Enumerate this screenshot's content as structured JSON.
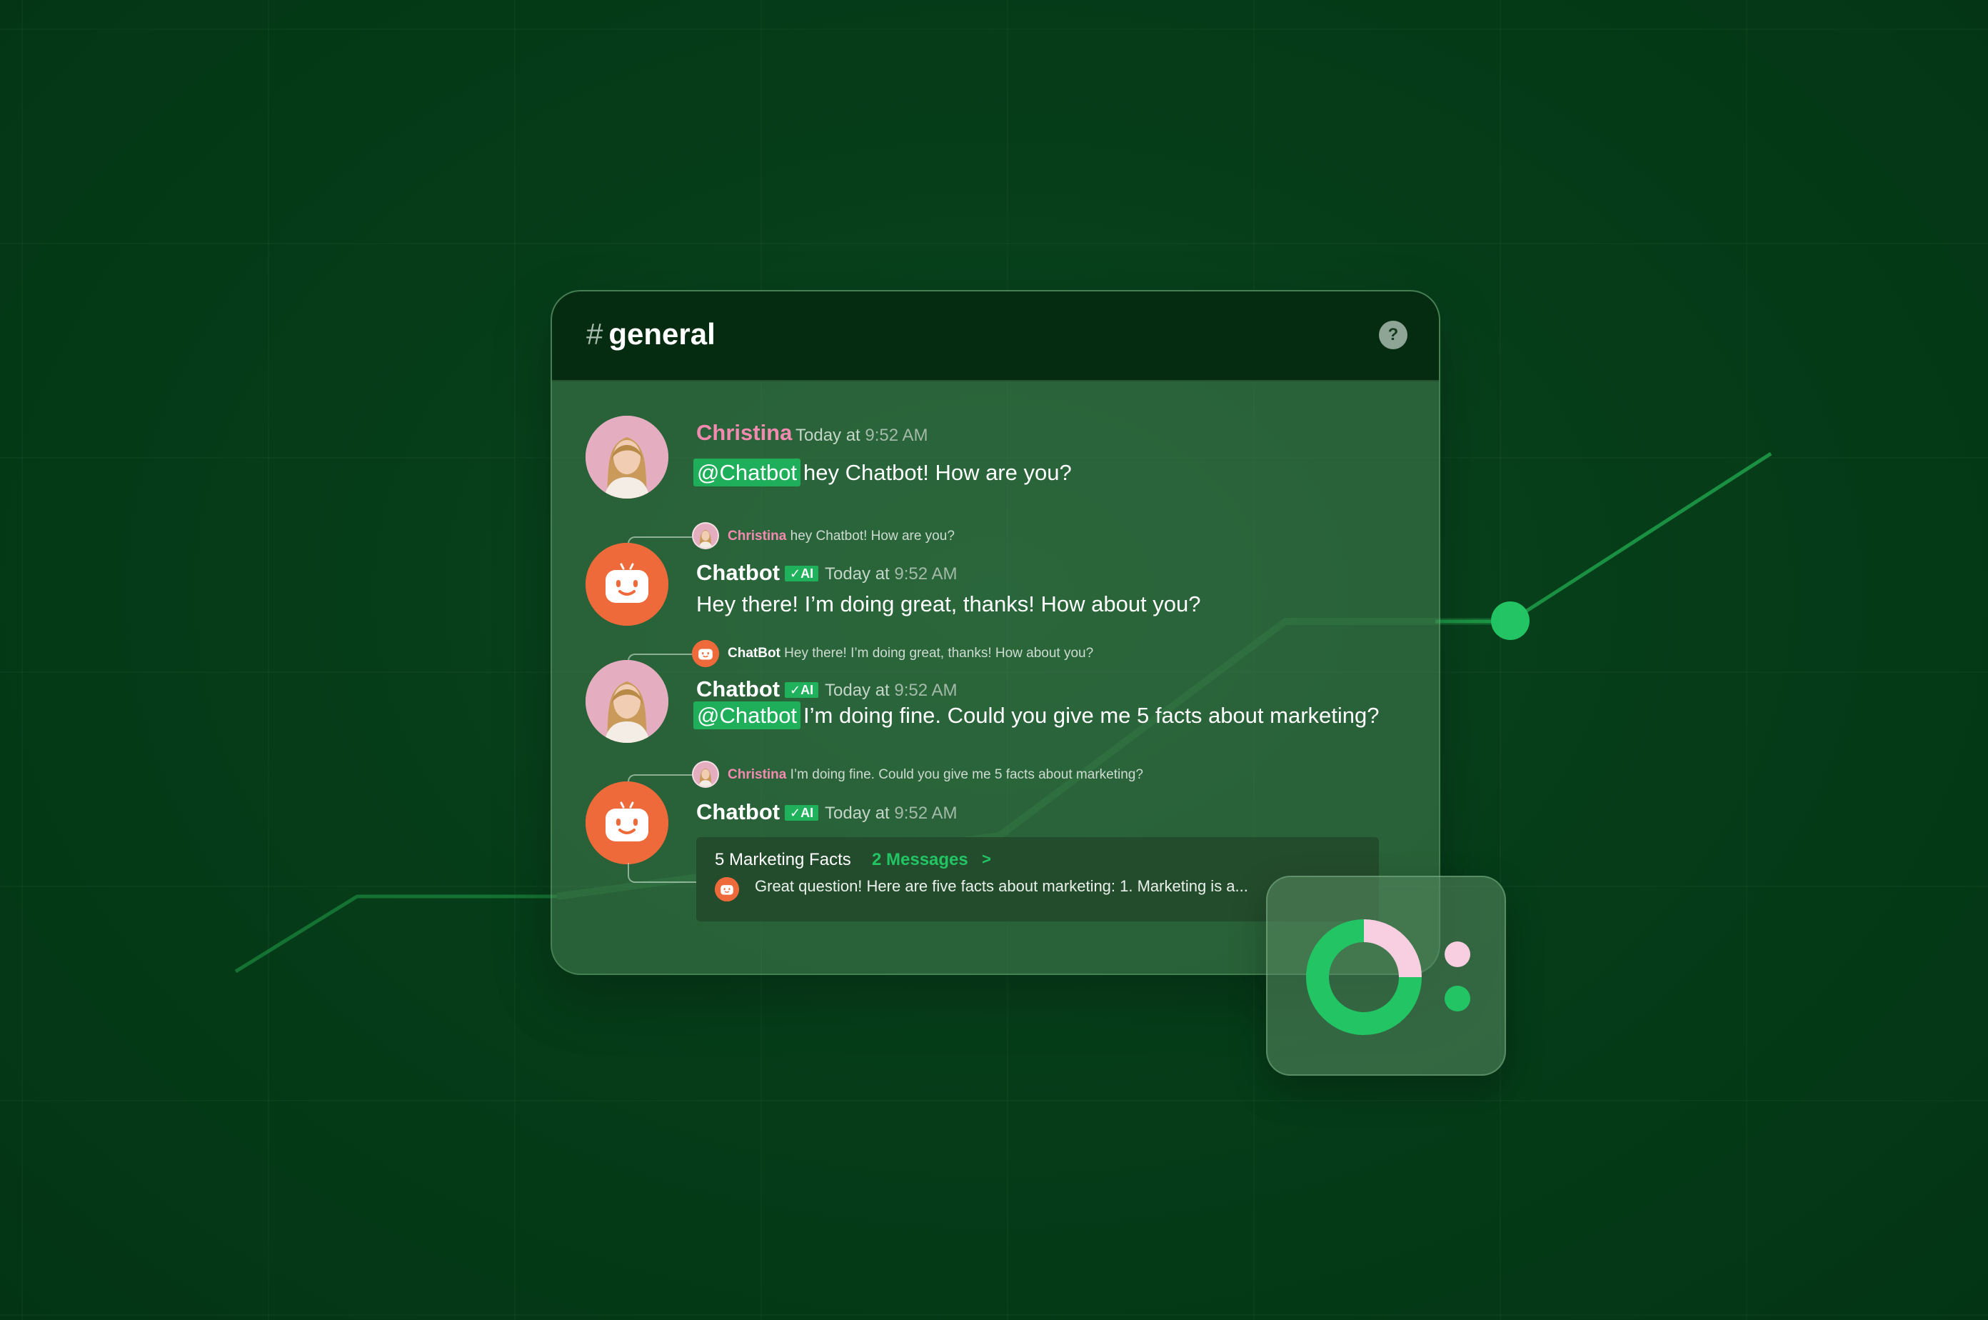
{
  "channel": {
    "hash": "#",
    "name": "general",
    "help_label": "?"
  },
  "messages": [
    {
      "author": "Christina",
      "time_prefix": "Today at",
      "time": "9:52 AM",
      "mention": "@Chatbot",
      "text": "hey Chatbot! How are you?"
    },
    {
      "author": "Chatbot",
      "badge": "AI",
      "time_prefix": "Today at",
      "time": "9:52 AM",
      "reply_author": "Christina",
      "reply_text": "hey Chatbot! How are you?",
      "text": "Hey there! I’m doing great, thanks! How about you?"
    },
    {
      "author": "Chatbot",
      "badge": "AI",
      "time_prefix": "Today at",
      "time": "9:52 AM",
      "reply_author": "ChatBot",
      "reply_text": "Hey there! I’m doing great, thanks! How about you?",
      "mention": "@Chatbot",
      "text": "I’m doing fine. Could you give me 5 facts about marketing?"
    },
    {
      "author": "Chatbot",
      "badge": "AI",
      "time_prefix": "Today at",
      "time": "9:52 AM",
      "reply_author": "Christina",
      "reply_text": "I’m doing fine. Could you give me 5 facts about marketing?"
    }
  ],
  "thread": {
    "title": "5 Marketing Facts",
    "count": "2 Messages",
    "arrow": ">",
    "preview": "Great question! Here are five facts about marketing:  1. Marketing is a..."
  },
  "chart_data": {
    "type": "pie",
    "donut": true,
    "slices": [
      {
        "color": "#f7cfe0",
        "value": 0.25
      },
      {
        "color": "#22c464",
        "value": 0.75
      }
    ],
    "legend_colors": [
      "#f7cfe0",
      "#22c464"
    ]
  },
  "colors": {
    "background": "#063d19",
    "accent_green": "#22c464",
    "christina_pink": "#f28ab0",
    "bot_orange": "#ef6a3a"
  }
}
